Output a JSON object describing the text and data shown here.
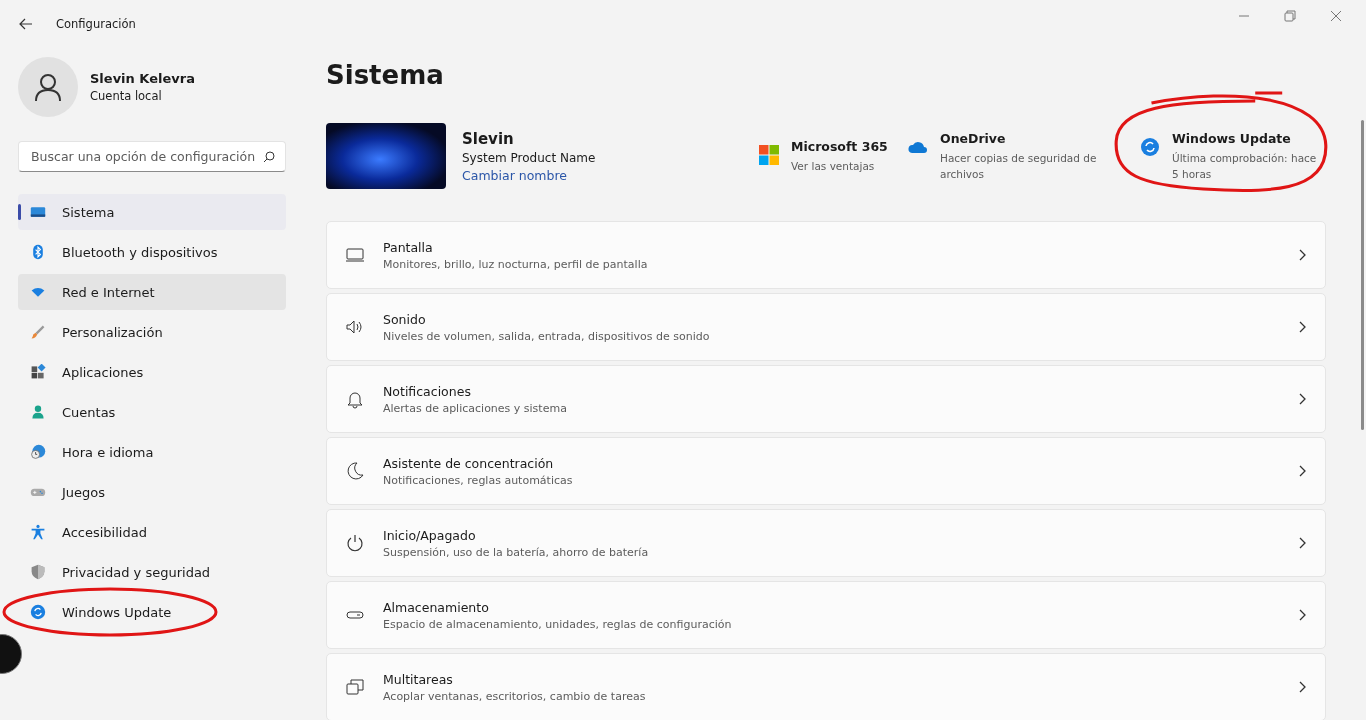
{
  "window": {
    "title": "Configuración"
  },
  "user": {
    "name": "Slevin Kelevra",
    "account": "Cuenta local"
  },
  "search": {
    "placeholder": "Buscar una opción de configuración"
  },
  "sidebar": {
    "items": [
      {
        "label": "Sistema",
        "selected": true,
        "hovered": false,
        "circled": false
      },
      {
        "label": "Bluetooth y dispositivos",
        "selected": false,
        "hovered": false,
        "circled": false
      },
      {
        "label": "Red e Internet",
        "selected": false,
        "hovered": true,
        "circled": false
      },
      {
        "label": "Personalización",
        "selected": false,
        "hovered": false,
        "circled": false
      },
      {
        "label": "Aplicaciones",
        "selected": false,
        "hovered": false,
        "circled": false
      },
      {
        "label": "Cuentas",
        "selected": false,
        "hovered": false,
        "circled": false
      },
      {
        "label": "Hora e idioma",
        "selected": false,
        "hovered": false,
        "circled": false
      },
      {
        "label": "Juegos",
        "selected": false,
        "hovered": false,
        "circled": false
      },
      {
        "label": "Accesibilidad",
        "selected": false,
        "hovered": false,
        "circled": false
      },
      {
        "label": "Privacidad y seguridad",
        "selected": false,
        "hovered": false,
        "circled": false
      },
      {
        "label": "Windows Update",
        "selected": false,
        "hovered": false,
        "circled": true
      }
    ]
  },
  "page": {
    "title": "Sistema"
  },
  "device": {
    "name": "Slevin",
    "model": "System Product Name",
    "rename_link": "Cambiar nombre"
  },
  "quick_links": [
    {
      "title": "Microsoft 365",
      "subtitle": "Ver las ventajas",
      "circled": false
    },
    {
      "title": "OneDrive",
      "subtitle": "Hacer copias de seguridad de archivos",
      "circled": false
    },
    {
      "title": "Windows Update",
      "subtitle": "Última comprobación: hace 5 horas",
      "circled": true
    }
  ],
  "settings": [
    {
      "title": "Pantalla",
      "subtitle": "Monitores, brillo, luz nocturna, perfil de pantalla"
    },
    {
      "title": "Sonido",
      "subtitle": "Niveles de volumen, salida, entrada, dispositivos de sonido"
    },
    {
      "title": "Notificaciones",
      "subtitle": "Alertas de aplicaciones y sistema"
    },
    {
      "title": "Asistente de concentración",
      "subtitle": "Notificaciones, reglas automáticas"
    },
    {
      "title": "Inicio/Apagado",
      "subtitle": "Suspensión, uso de la batería, ahorro de batería"
    },
    {
      "title": "Almacenamiento",
      "subtitle": "Espacio de almacenamiento, unidades, reglas de configuración"
    },
    {
      "title": "Multitareas",
      "subtitle": "Acoplar ventanas, escritorios, cambio de tareas"
    }
  ]
}
